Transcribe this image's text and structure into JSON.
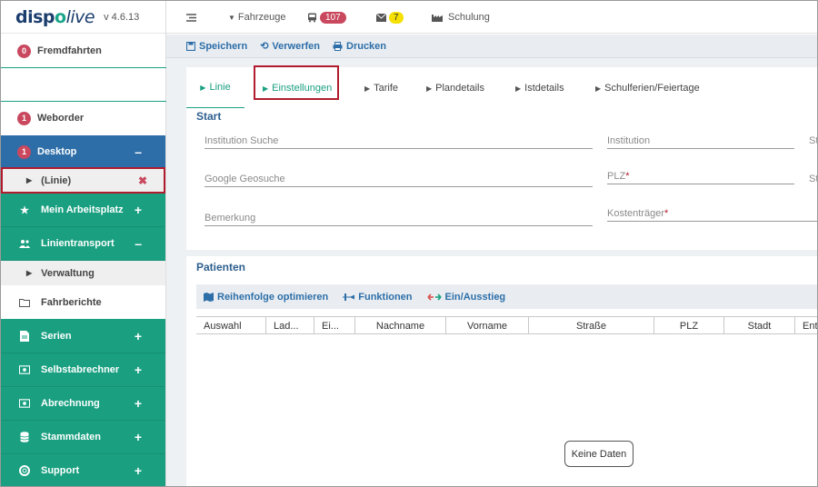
{
  "app": {
    "logo": "dispolive",
    "version": "v 4.6.13"
  },
  "sidebar": {
    "fremdfahrten": {
      "count": "0",
      "label": "Fremdfahrten"
    },
    "weborder": {
      "count": "1",
      "label": "Weborder"
    },
    "desktop": {
      "count": "1",
      "label": "Desktop",
      "toggle": "–"
    },
    "linie_tab": {
      "label": "(Linie)",
      "close": "✖"
    },
    "mein_arbeitsplatz": {
      "label": "Mein Arbeitsplatz",
      "toggle": "+"
    },
    "linientransport": {
      "label": "Linientransport",
      "toggle": "–"
    },
    "verwaltung": {
      "label": "Verwaltung"
    },
    "fahrberichte": {
      "label": "Fahrberichte"
    },
    "serien": {
      "label": "Serien",
      "toggle": "+"
    },
    "selbstabrechner": {
      "label": "Selbstabrechner",
      "toggle": "+"
    },
    "abrechnung": {
      "label": "Abrechnung",
      "toggle": "+"
    },
    "stammdaten": {
      "label": "Stammdaten",
      "toggle": "+"
    },
    "support": {
      "label": "Support",
      "toggle": "+"
    }
  },
  "topbar": {
    "fahrzeuge": "Fahrzeuge",
    "bus_count": "107",
    "mail_count": "7",
    "schulung": "Schulung"
  },
  "toolbar": {
    "save": "Speichern",
    "discard": "Verwerfen",
    "print": "Drucken"
  },
  "tabs": [
    "Linie",
    "Einstellungen",
    "Tarife",
    "Plandetails",
    "Istdetails",
    "Schulferien/Feiertage"
  ],
  "start": {
    "title": "Start",
    "institution_suche": "Institution Suche",
    "institution": "Institution",
    "google_geosuche": "Google Geosuche",
    "plz": "PLZ",
    "bemerkung": "Bemerkung",
    "kostentraeger": "Kostenträger",
    "cut_label_1": "St",
    "cut_label_2": "St",
    "required_mark": "*"
  },
  "patienten": {
    "title": "Patienten",
    "actions": [
      "Reihenfolge optimieren",
      "Funktionen",
      "Ein/Ausstieg"
    ],
    "columns": [
      "Auswahl",
      "Lad...",
      "Ei...",
      "Nachname",
      "Vorname",
      "Straße",
      "PLZ",
      "Stadt",
      "Entf"
    ],
    "empty": "Keine Daten"
  },
  "colors": {
    "green": "#1aa081",
    "blue": "#2d6ea8",
    "badge_red": "#c9485e",
    "highlight_box": "#b01c2e"
  }
}
